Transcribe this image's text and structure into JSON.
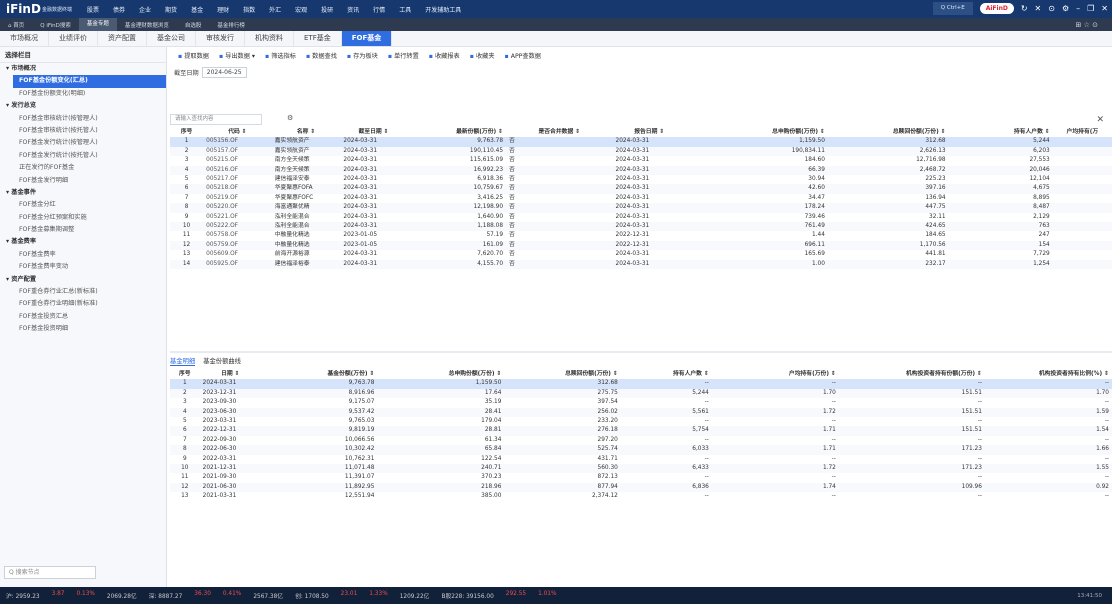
{
  "app": {
    "logo": "iFinD",
    "logo_sub": "金融数据终端",
    "menu": [
      "股票",
      "债券",
      "企业",
      "期货",
      "基金",
      "理财",
      "指数",
      "外汇",
      "宏观",
      "投研",
      "资讯",
      "行情",
      "工具",
      "开发辅助工具"
    ],
    "search": "Q Ctrl+E",
    "ai": "AiFinD"
  },
  "nav": {
    "items": [
      "⌂ 首页",
      "Q iFinD搜索",
      "基金专题",
      "基金理财数据浏览",
      "自选股",
      "基金排行榜"
    ],
    "active": 2
  },
  "tabs": {
    "items": [
      "市场概况",
      "业绩评价",
      "资产配置",
      "基金公司",
      "审核发行",
      "机构资料",
      "ETF基金",
      "FOF基金"
    ],
    "active": 7
  },
  "sidebar": {
    "header": "选择栏目",
    "search": "Q 搜索节点",
    "items": [
      {
        "t": "▾ 市场概况",
        "g": true
      },
      {
        "t": "FOF基金份额变化(汇总)",
        "s": true
      },
      {
        "t": "FOF基金份额变化(明细)"
      },
      {
        "t": "▾ 发行总览",
        "g": true
      },
      {
        "t": "FOF基金审核统计(按管理人)"
      },
      {
        "t": "FOF基金审核统计(按托管人)"
      },
      {
        "t": "FOF基金发行统计(按管理人)"
      },
      {
        "t": "FOF基金发行统计(按托管人)"
      },
      {
        "t": "正在发行的FOF基金"
      },
      {
        "t": "FOF基金发行明细"
      },
      {
        "t": "▾ 基金事件",
        "g": true
      },
      {
        "t": "FOF基金分红"
      },
      {
        "t": "FOF基金分红预案和实施"
      },
      {
        "t": "FOF基金募集期调整"
      },
      {
        "t": "▾ 基金费率",
        "g": true
      },
      {
        "t": "FOF基金费率"
      },
      {
        "t": "FOF基金费率变动"
      },
      {
        "t": "▾ 资产配置",
        "g": true
      },
      {
        "t": "FOF重仓券行业汇总(新标准)"
      },
      {
        "t": "FOF重仓券行业明细(新标准)"
      },
      {
        "t": "FOF基金投资汇总"
      },
      {
        "t": "FOF基金投资明细"
      }
    ]
  },
  "toolbar": [
    "提取数据",
    "导出数据 ▾",
    "筛选指标",
    "数据查找",
    "存为板块",
    "单行转置",
    "收藏报表",
    "收藏夹",
    "APP查数据"
  ],
  "date": {
    "label": "截至日期",
    "value": "2024-06-25"
  },
  "filter_placeholder": "请输入查找内容",
  "t1": {
    "headers": [
      "序号",
      "代码 ⇕",
      "名称 ⇕",
      "截至日期 ⇕",
      "最新份额(万份) ⇕",
      "是否合并数据 ⇕",
      "报告日期 ⇕",
      "总申购份额(万份) ⇕",
      "总赎回份额(万份) ⇕",
      "持有人户数 ⇕",
      "户均持有(万"
    ],
    "rows": [
      [
        "1",
        "005156.OF",
        "嘉实领航资产",
        "2024-03-31",
        "9,763.78",
        "否",
        "2024-03-31",
        "1,159.50",
        "312.68",
        "5,244",
        ""
      ],
      [
        "2",
        "005157.OF",
        "嘉实领航资产",
        "2024-03-31",
        "190,110.45",
        "否",
        "2024-03-31",
        "190,834.11",
        "2,626.13",
        "6,203",
        ""
      ],
      [
        "3",
        "005215.OF",
        "南方全天候策",
        "2024-03-31",
        "115,615.09",
        "否",
        "2024-03-31",
        "184.60",
        "12,716.98",
        "27,553",
        ""
      ],
      [
        "4",
        "005216.OF",
        "南方全天候策",
        "2024-03-31",
        "16,992.23",
        "否",
        "2024-03-31",
        "66.39",
        "2,468.72",
        "20,046",
        ""
      ],
      [
        "5",
        "005217.OF",
        "建信福泽安泰",
        "2024-03-31",
        "6,918.36",
        "否",
        "2024-03-31",
        "30.94",
        "225.23",
        "12,104",
        ""
      ],
      [
        "6",
        "005218.OF",
        "华夏聚惠FOFA",
        "2024-03-31",
        "10,759.67",
        "否",
        "2024-03-31",
        "42.60",
        "397.16",
        "4,675",
        ""
      ],
      [
        "7",
        "005219.OF",
        "华夏聚惠FOFC",
        "2024-03-31",
        "3,416.25",
        "否",
        "2024-03-31",
        "34.47",
        "136.94",
        "8,895",
        ""
      ],
      [
        "8",
        "005220.OF",
        "海富通聚优精",
        "2024-03-31",
        "12,198.90",
        "否",
        "2024-03-31",
        "178.24",
        "447.75",
        "8,487",
        ""
      ],
      [
        "9",
        "005221.OF",
        "泓利全能混合",
        "2024-03-31",
        "1,640.90",
        "否",
        "2024-03-31",
        "739.46",
        "32.11",
        "2,129",
        ""
      ],
      [
        "10",
        "005222.OF",
        "泓利全能混合",
        "2024-03-31",
        "1,188.08",
        "否",
        "2024-03-31",
        "761.49",
        "424.65",
        "763",
        ""
      ],
      [
        "11",
        "005758.OF",
        "中融量化精选",
        "2023-01-05",
        "57.19",
        "否",
        "2022-12-31",
        "1.44",
        "184.65",
        "247",
        ""
      ],
      [
        "12",
        "005759.OF",
        "中融量化精选",
        "2023-01-05",
        "161.09",
        "否",
        "2022-12-31",
        "696.11",
        "1,170.56",
        "154",
        ""
      ],
      [
        "13",
        "005609.OF",
        "前海开源裕源",
        "2024-03-31",
        "7,620.70",
        "否",
        "2024-03-31",
        "165.69",
        "441.81",
        "7,729",
        ""
      ],
      [
        "14",
        "005925.OF",
        "建信福泽裕泰",
        "2024-03-31",
        "4,155.70",
        "否",
        "2024-03-31",
        "1.00",
        "232.17",
        "1,254",
        ""
      ]
    ]
  },
  "subtabs": [
    "基金明细",
    "基金份额曲线"
  ],
  "t2": {
    "headers": [
      "序号",
      "日期 ⇕",
      "基金份额(万份) ⇕",
      "总申购份额(万份) ⇕",
      "总赎回份额(万份) ⇕",
      "持有人户数 ⇕",
      "户均持有(万份) ⇕",
      "机构投资者持有份额(万份) ⇕",
      "机构投资者持有比例(%) ⇕"
    ],
    "rows": [
      [
        "1",
        "2024-03-31",
        "9,763.78",
        "1,159.50",
        "312.68",
        "--",
        "--",
        "--",
        "--"
      ],
      [
        "2",
        "2023-12-31",
        "8,916.96",
        "17.64",
        "275.75",
        "5,244",
        "1.70",
        "151.51",
        "1.70"
      ],
      [
        "3",
        "2023-09-30",
        "9,175.07",
        "35.19",
        "397.54",
        "--",
        "--",
        "--",
        "--"
      ],
      [
        "4",
        "2023-06-30",
        "9,537.42",
        "28.41",
        "256.02",
        "5,561",
        "1.72",
        "151.51",
        "1.59"
      ],
      [
        "5",
        "2023-03-31",
        "9,765.03",
        "179.04",
        "233.20",
        "--",
        "--",
        "--",
        "--"
      ],
      [
        "6",
        "2022-12-31",
        "9,819.19",
        "28.81",
        "276.18",
        "5,754",
        "1.71",
        "151.51",
        "1.54"
      ],
      [
        "7",
        "2022-09-30",
        "10,066.56",
        "61.34",
        "297.20",
        "--",
        "--",
        "--",
        "--"
      ],
      [
        "8",
        "2022-06-30",
        "10,302.42",
        "65.84",
        "525.74",
        "6,033",
        "1.71",
        "171.23",
        "1.66"
      ],
      [
        "9",
        "2022-03-31",
        "10,762.31",
        "122.54",
        "431.71",
        "--",
        "--",
        "--",
        "--"
      ],
      [
        "10",
        "2021-12-31",
        "11,071.48",
        "240.71",
        "560.30",
        "6,433",
        "1.72",
        "171.23",
        "1.55"
      ],
      [
        "11",
        "2021-09-30",
        "11,391.07",
        "370.23",
        "872.13",
        "--",
        "--",
        "--",
        "--"
      ],
      [
        "12",
        "2021-06-30",
        "11,892.95",
        "218.96",
        "877.94",
        "6,836",
        "1.74",
        "109.96",
        "0.92"
      ],
      [
        "13",
        "2021-03-31",
        "12,551.94",
        "385.00",
        "2,374.12",
        "--",
        "--",
        "--",
        "--"
      ]
    ]
  },
  "status": {
    "items": [
      "沪: 2959.23",
      "3.87",
      "0.13%",
      "2069.28亿",
      "深: 8887.27",
      "36.30",
      "0.41%",
      "2567.38亿",
      "创: 1708.50",
      "23.01",
      "1.33%",
      "1209.22亿",
      "B股228: 39156.00",
      "292.55",
      "1.01%"
    ],
    "time": "13:41:50"
  }
}
